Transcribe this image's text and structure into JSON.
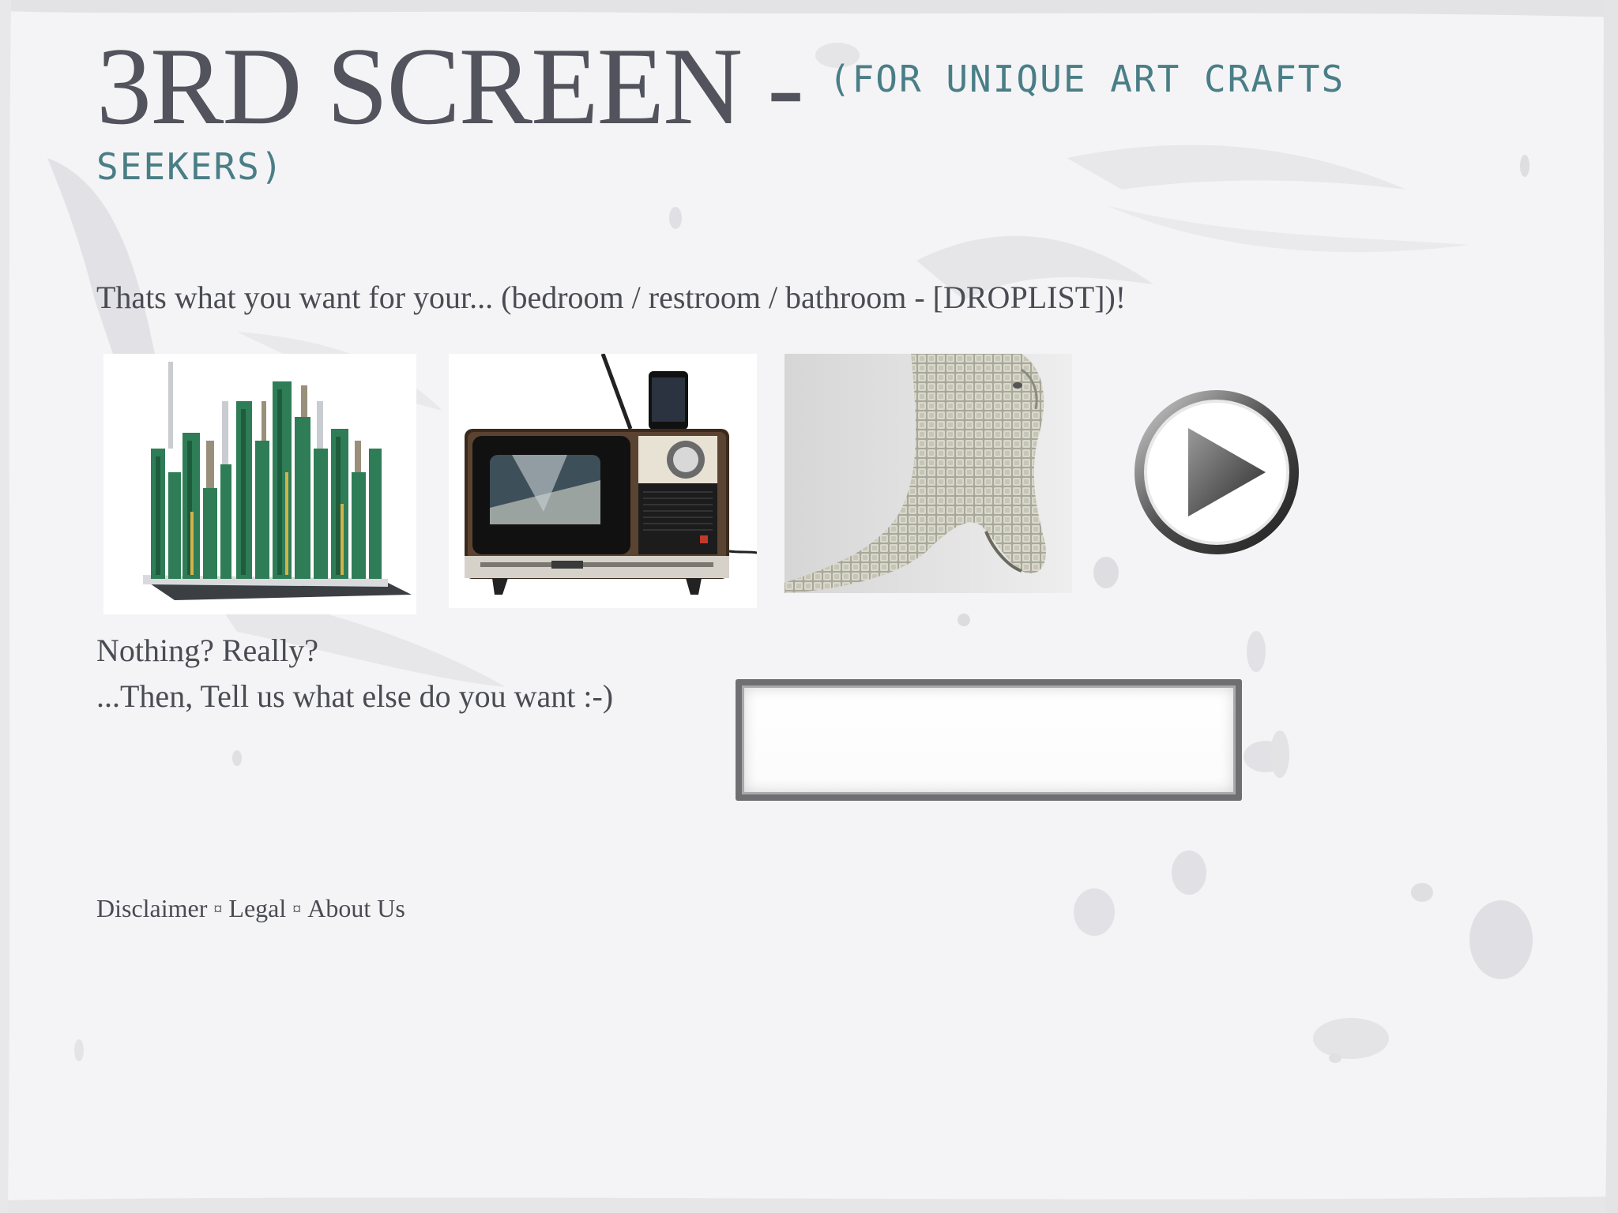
{
  "header": {
    "title_main": "3RD SCREEN - ",
    "title_sub_line1": "(FOR UNIQUE ART CRAFTS",
    "title_sub_line2": "SEEKERS)"
  },
  "question": {
    "text": "Thats what you want for your... (bedroom / restroom / bathroom - [DROPLIST])!"
  },
  "gallery": {
    "items": [
      {
        "name": "circuit-board-city"
      },
      {
        "name": "retro-tv-dock"
      },
      {
        "name": "keyboard-keys-horse"
      }
    ],
    "play_icon": "play-icon"
  },
  "prompt": {
    "line1": "Nothing? Really?",
    "line2": "...Then, Tell us what else do you want :-)"
  },
  "wish_input": {
    "value": "",
    "placeholder": ""
  },
  "footer": {
    "links": [
      "Disclaimer",
      "Legal",
      "About Us"
    ],
    "separator": "¤"
  },
  "colors": {
    "title": "#52535c",
    "subtitle": "#4a7e86",
    "text": "#4a4b53",
    "background": "#f4f4f6"
  }
}
